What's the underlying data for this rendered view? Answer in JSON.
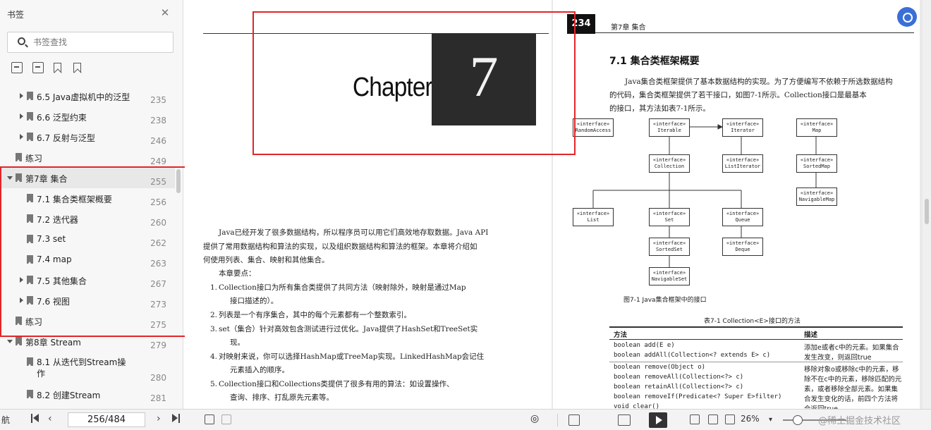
{
  "sidebar": {
    "title": "书签",
    "search_placeholder": "书签查找",
    "items": [
      {
        "label": "6.5 Java虚拟机中的泛型",
        "page": "235"
      },
      {
        "label": "6.6 泛型约束",
        "page": "238"
      },
      {
        "label": "6.7 反射与泛型",
        "page": "246"
      },
      {
        "label": "练习",
        "page": "249"
      },
      {
        "label": "第7章 集合",
        "page": "255"
      },
      {
        "label": "7.1 集合类框架概要",
        "page": "256"
      },
      {
        "label": "7.2 迭代器",
        "page": "260"
      },
      {
        "label": "7.3 set",
        "page": "262"
      },
      {
        "label": "7.4 map",
        "page": "263"
      },
      {
        "label": "7.5 其他集合",
        "page": "267"
      },
      {
        "label": "7.6 视图",
        "page": "273"
      },
      {
        "label": "练习",
        "page": "275"
      },
      {
        "label": "第8章 Stream",
        "page": "279"
      },
      {
        "label": "8.1 从迭代到Stream操作",
        "page": "280"
      },
      {
        "label": "8.2 创建Stream",
        "page": "281"
      }
    ]
  },
  "left_page": {
    "chapter_word": "Chapter",
    "chapter_number": "7",
    "intro_1": "Java已经开发了很多数据结构，所以程序员可以用它们高效地存取数据。Java API",
    "intro_2": "提供了常用数据结构和算法的实现，以及组织数据结构和算法的框架。本章将介绍如",
    "intro_3": "何使用列表、集合、映射和其他集合。",
    "key_points": "本章要点：",
    "points": [
      {
        "n": "1.",
        "l1": "Collection接口为所有集合类提供了共同方法（映射除外，映射是通过Map",
        "l2": "接口描述的）。"
      },
      {
        "n": "2.",
        "l1": "列表是一个有序集合，其中的每个元素都有一个整数索引。",
        "l2": ""
      },
      {
        "n": "3.",
        "l1": "set（集合）针对高效包含测试进行过优化。Java提供了HashSet和TreeSet实",
        "l2": "现。"
      },
      {
        "n": "4.",
        "l1": "对映射来说，你可以选择HashMap或TreeMap实现。LinkedHashMap会记住",
        "l2": "元素插入的顺序。"
      },
      {
        "n": "5.",
        "l1": "Collection接口和Collections类提供了很多有用的算法：如设置操作、",
        "l2": "查询、排序、打乱原先元素等。"
      }
    ]
  },
  "right_page": {
    "page_number": "234",
    "header": "第7章   集合",
    "section_title": "7.1   集合类框架概要",
    "para_1": "Java集合类框架提供了基本数据结构的实现。为了方便编写不依赖于所选数据结构",
    "para_2": "的代码，集合类框架提供了若干接口，如图7-1所示。Collection接口是最基本",
    "para_3": "的接口，其方法如表7-1所示。",
    "uml": [
      {
        "stereo": "«interface»",
        "name": "RandomAccess"
      },
      {
        "stereo": "«interface»",
        "name": "Iterable"
      },
      {
        "stereo": "«interface»",
        "name": "Iterator"
      },
      {
        "stereo": "«interface»",
        "name": "Map"
      },
      {
        "stereo": "«interface»",
        "name": "Collection"
      },
      {
        "stereo": "«interface»",
        "name": "ListIterator"
      },
      {
        "stereo": "«interface»",
        "name": "SortedMap"
      },
      {
        "stereo": "«interface»",
        "name": "NavigableMap"
      },
      {
        "stereo": "«interface»",
        "name": "List"
      },
      {
        "stereo": "«interface»",
        "name": "Set"
      },
      {
        "stereo": "«interface»",
        "name": "Queue"
      },
      {
        "stereo": "«interface»",
        "name": "SortedSet"
      },
      {
        "stereo": "«interface»",
        "name": "Deque"
      },
      {
        "stereo": "«interface»",
        "name": "NavigableSet"
      }
    ],
    "figure_caption": "图7-1   Java集合框架中的接口",
    "table_caption": "表7-1   Collection<E>接口的方法",
    "table_head": {
      "method": "方法",
      "desc": "描述"
    },
    "table_rows": [
      {
        "method": "boolean add(E e)",
        "desc": "添加e或者c中的元素。如果集合"
      },
      {
        "method": "boolean addAll(Collection<? extends E> c)",
        "desc": "发生改变，则返回true"
      },
      {
        "method": "boolean remove(Object o)",
        "desc": "移除对象o或移除c中的元素，移"
      },
      {
        "method": "boolean removeAll(Collection<?> c)",
        "desc": "除不在c中的元素，移除匹配的元"
      },
      {
        "method": "boolean retainAll(Collection<?> c)",
        "desc": "素，或者移除全部元素。如果集"
      },
      {
        "method": "boolean removeIf(Predicate<? Super E>filter)",
        "desc": "合发生变化的话，前四个方法将"
      },
      {
        "method": "void clear()",
        "desc": "会返回true"
      }
    ]
  },
  "status": {
    "nav_label": "航",
    "page_display": "256/484",
    "zoom": "26%",
    "watermark": "@稀土掘金技术社区"
  },
  "colors": {
    "highlight": "#e0262a",
    "accent": "#3b6fd8"
  }
}
